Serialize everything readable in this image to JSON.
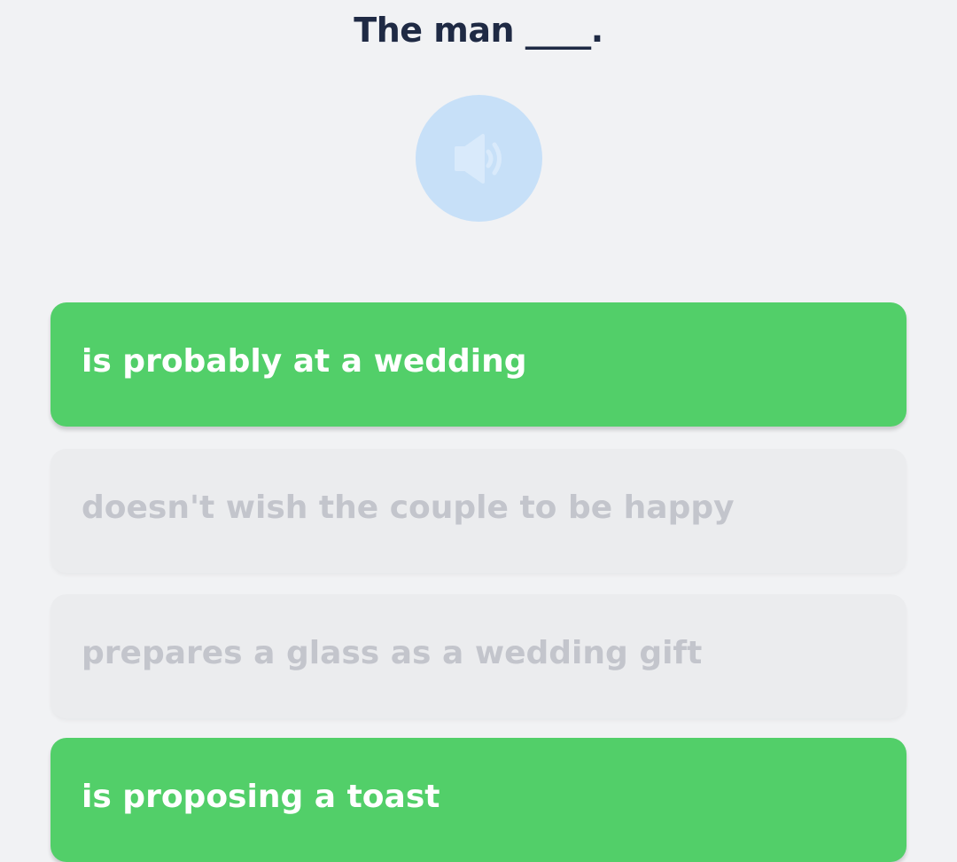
{
  "question": {
    "text": "The man ____."
  },
  "audio": {
    "icon": "speaker-icon",
    "color": "#c7e0f8"
  },
  "options": [
    {
      "label": "is probably at a wedding",
      "state": "selected"
    },
    {
      "label": "doesn't wish the couple to be happy",
      "state": "disabled"
    },
    {
      "label": "prepares a glass as a wedding gift",
      "state": "disabled"
    },
    {
      "label": "is proposing a toast",
      "state": "selected"
    }
  ],
  "colors": {
    "selected": "#52cf69",
    "disabled": "#ebecee",
    "question_text": "#1f2a44",
    "background": "#f1f2f4"
  }
}
